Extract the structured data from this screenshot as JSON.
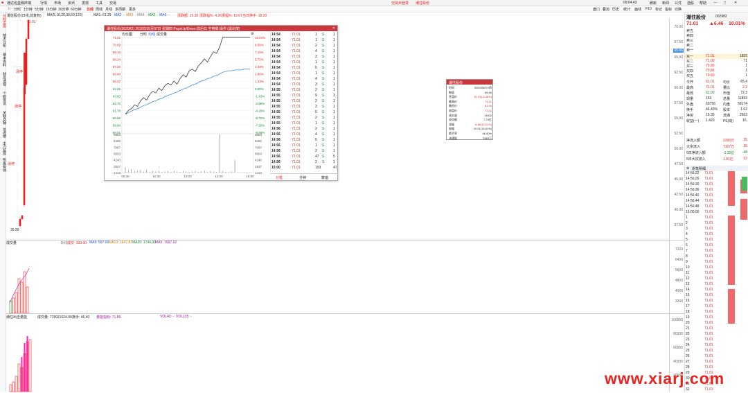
{
  "titlebar": {
    "app": "通达信金融终端",
    "menus": [
      "行情",
      "市场",
      "资讯",
      "发现",
      "工具",
      "交易"
    ],
    "center": "交易未登录",
    "stock_title": "潮住股份",
    "time": "09:04:43",
    "right_items": [
      "刷新",
      "新闻",
      "公式",
      "选股",
      "帮助"
    ]
  },
  "toolbar": {
    "items": [
      "□",
      "分时",
      "1分钟",
      "5分钟",
      "15分钟",
      "30分钟",
      "60分钟",
      "日线",
      "周线",
      "月线",
      "多周期",
      "更多"
    ],
    "right_items": [
      "盘口",
      "叠加",
      "历史",
      "统计",
      "画线",
      "F10",
      "标记",
      "指标",
      "切换"
    ]
  },
  "legend1": {
    "title": "潮住股份(日线,前复权)",
    "ma_label": "MA(5,10,20,30,60,120)",
    "ma1": "MA1: 61.29",
    "ma2": "MA2: -",
    "ma3": "MA3: -",
    "ma4": "MA4: -",
    "ma5": "MA5: -",
    "ma6": "MA6: -",
    "rise": "涨跌额: 15.30",
    "rise_pct": "涨跌幅%: 4.26",
    "turnover": "振幅%: 19.67",
    "vol_ratio": "当日换手: 18.20"
  },
  "lefttabs": [
    "分时走势",
    "技术分析",
    "基本资料",
    "财务透视",
    "个股资讯",
    "关联品种",
    "龙虎榜",
    "主力监控",
    "所属板块"
  ],
  "main_chart": {
    "high_label": "71.01",
    "low_label": "35.59",
    "annotations": [
      "涨停",
      "涨停",
      "涨停"
    ],
    "yaxis": [
      "70.00",
      "67.50",
      "65.00",
      "62.50",
      "60.00",
      "57.50",
      "55.00",
      "52.50",
      "50.00",
      "47.50",
      "45.00",
      "42.50",
      "40.00",
      "37.50"
    ],
    "yaxis_highlight": "65.66"
  },
  "volume_panel": {
    "title": "成交量",
    "vol": "成交: 333.00",
    "vol_ma1": "MA5: 587.00",
    "vol_ma2": "MA10: 1647.81",
    "vol_ma3": "MA20: 1744.00",
    "vol_ma4": "MA5: 7697.62",
    "yaxis": [
      "7200",
      "6400",
      "5600",
      "4800",
      "4000",
      "3200"
    ]
  },
  "indicator_panel": {
    "title": "潮住出击量能",
    "ind_vol": "成交量: 778921024.00",
    "ind_val": "换手: 46.40",
    "ind_name": "量能指标: 71.89",
    "ind_vol2": "VOL40: -",
    "ind_vol3": "VOL135: -",
    "yaxis": [
      "100000",
      "80000",
      "60000",
      "40000",
      "20000"
    ]
  },
  "popup": {
    "header": "潮住股份(002982) 2020年05月07日 星期四 PageUp/Down:前后日 空格键:操作 (退出按)",
    "tabs": [
      "均价图",
      "分时",
      "均线",
      "成交量"
    ],
    "left_axis": [
      "71.01",
      "70.09",
      "69.16",
      "68.24",
      "67.32",
      "66.40",
      "65.47",
      "64.55",
      "63.63",
      "62.70",
      "61.78",
      "60.86",
      "59.94",
      "59.01",
      "9883",
      "8480",
      "7067",
      "5653",
      "4240",
      "2827",
      "1413"
    ],
    "right_axis": [
      "10.01%",
      "8.58%",
      "7.15%",
      "5.72%",
      "4.29%",
      "2.86%",
      "1.43%",
      "0.00%",
      "-1.43%",
      "-2.86%",
      "-4.29%",
      "-5.72%",
      "-7.15%",
      "-8.58%",
      "9883",
      "8480",
      "7067",
      "5653",
      "4240",
      "2827",
      "1413"
    ],
    "x_axis": [
      "09:30",
      "10:30",
      "13:00",
      "14:00",
      "15:00"
    ],
    "price_series": [
      61.3,
      61.8,
      62.0,
      62.5,
      62.3,
      63.0,
      63.4,
      63.1,
      63.8,
      64.2,
      64.0,
      64.6,
      64.3,
      64.9,
      65.2,
      65.0,
      65.5,
      65.1,
      65.8,
      66.3,
      66.0,
      66.8,
      67.0,
      66.7,
      67.4,
      67.8,
      68.3,
      67.9,
      68.6,
      69.2,
      69.0,
      69.8,
      71.01,
      71.01,
      71.01,
      71.01,
      71.01,
      71.01,
      71.01,
      71.01,
      71.01,
      71.01
    ],
    "avg_series": [
      61.3,
      61.5,
      61.7,
      61.9,
      62.0,
      62.2,
      62.4,
      62.5,
      62.7,
      62.9,
      63.0,
      63.2,
      63.3,
      63.5,
      63.7,
      63.8,
      64.0,
      64.1,
      64.3,
      64.5,
      64.6,
      64.8,
      65.0,
      65.1,
      65.3,
      65.5,
      65.6,
      65.8,
      65.9,
      66.1,
      66.2,
      66.4,
      66.6,
      66.7,
      66.8,
      66.8,
      66.9,
      66.9,
      66.9,
      67.0,
      67.0,
      67.0
    ],
    "vol_series": [
      1400,
      600,
      900,
      400,
      500,
      700,
      300,
      600,
      200,
      400,
      300,
      500,
      200,
      300,
      400,
      200,
      500,
      300,
      200,
      400,
      300,
      200,
      300,
      400,
      200,
      300,
      500,
      200,
      400,
      300,
      200,
      9883,
      400,
      200,
      100,
      300,
      3200,
      100,
      50,
      100,
      80,
      60
    ],
    "trades": [
      {
        "t": "14:54",
        "p": "71.01",
        "v": "1",
        "s": "S",
        "n": "1"
      },
      {
        "t": "14:54",
        "p": "71.01",
        "v": "1",
        "s": "S",
        "n": "1"
      },
      {
        "t": "14:54",
        "p": "71.01",
        "v": "2",
        "s": "S",
        "n": "1"
      },
      {
        "t": "14:54",
        "p": "71.01",
        "v": "4",
        "s": "S",
        "n": "1"
      },
      {
        "t": "14:54",
        "p": "71.01",
        "v": "3",
        "s": "S",
        "n": "1"
      },
      {
        "t": "14:54",
        "p": "71.01",
        "v": "1",
        "s": "S",
        "n": "1"
      },
      {
        "t": "14:54",
        "p": "71.01",
        "v": "5",
        "s": "S",
        "n": "1"
      },
      {
        "t": "14:54",
        "p": "71.01",
        "v": "1",
        "s": "S",
        "n": "1"
      },
      {
        "t": "14:54",
        "p": "71.01",
        "v": "4",
        "s": "S",
        "n": "1"
      },
      {
        "t": "14:54",
        "p": "71.01",
        "v": "3",
        "s": "S",
        "n": "1"
      },
      {
        "t": "14:55",
        "p": "71.01",
        "v": "2",
        "s": "S",
        "n": "1"
      },
      {
        "t": "14:55",
        "p": "71.01",
        "v": "9",
        "s": "S",
        "n": "3"
      },
      {
        "t": "14:55",
        "p": "71.01",
        "v": "2",
        "s": "S",
        "n": "1"
      },
      {
        "t": "14:55",
        "p": "71.01",
        "v": "3",
        "s": "S",
        "n": "1"
      },
      {
        "t": "14:55",
        "p": "71.01",
        "v": "5",
        "s": "S",
        "n": "1"
      },
      {
        "t": "14:55",
        "p": "71.01",
        "v": "2",
        "s": "S",
        "n": "1"
      },
      {
        "t": "14:55",
        "p": "71.01",
        "v": "1",
        "s": "S",
        "n": "1"
      },
      {
        "t": "14:56",
        "p": "71.01",
        "v": "2",
        "s": "S",
        "n": "1"
      },
      {
        "t": "14:56",
        "p": "71.01",
        "v": "4",
        "s": "S",
        "n": "1"
      },
      {
        "t": "14:56",
        "p": "71.01",
        "v": "5",
        "s": "S",
        "n": "1"
      },
      {
        "t": "14:56",
        "p": "71.01",
        "v": "1",
        "s": "S",
        "n": "1"
      },
      {
        "t": "14:56",
        "p": "71.01",
        "v": "2",
        "s": "S",
        "n": "1"
      },
      {
        "t": "14:56",
        "p": "71.01",
        "v": "47",
        "s": "S",
        "n": "5"
      },
      {
        "t": "14:56",
        "p": "71.01",
        "v": "2",
        "s": "S",
        "n": "1"
      },
      {
        "t": "15:00",
        "p": "71.01",
        "v": "153",
        "s": "",
        "n": "47"
      }
    ],
    "foot": [
      "分笔",
      "分钟",
      "数值"
    ]
  },
  "infobox": {
    "title": "潮住股份",
    "rows": [
      {
        "k": "时间",
        "v": "2020/05/07/四"
      },
      {
        "k": "数值",
        "v": "65.66"
      },
      {
        "k": "开盘价",
        "v": "61.01(-5.46%)"
      },
      {
        "k": "最高价",
        "v": "71.01"
      },
      {
        "k": "最低价",
        "v": "61.00"
      },
      {
        "k": "收盘价",
        "v": "71.01"
      },
      {
        "k": "成交量",
        "v": "11602"
      },
      {
        "k": "成交额",
        "v": "7.79亿"
      },
      {
        "k": "涨幅",
        "v": "6.46(10.01%)"
      },
      {
        "k": "振幅",
        "v": "10.01(15.51%)"
      },
      {
        "k": "换手率",
        "v": "46.40%"
      },
      {
        "k": "流通股",
        "v": "2583万"
      }
    ]
  },
  "quote": {
    "name": "潮住股份",
    "code": "002982",
    "price": "71.01",
    "change": "▲6.46",
    "pct": "10.01%",
    "sell": [
      {
        "k": "卖五",
        "p": "",
        "v": ""
      },
      {
        "k": "卖四",
        "p": "",
        "v": ""
      },
      {
        "k": "卖三",
        "p": "",
        "v": ""
      },
      {
        "k": "卖二",
        "p": "",
        "v": ""
      },
      {
        "k": "卖一",
        "p": "",
        "v": ""
      }
    ],
    "buy": [
      {
        "k": "买一",
        "p": "71.01",
        "v": "1855"
      },
      {
        "k": "买二",
        "p": "71.00",
        "v": "71"
      },
      {
        "k": "买三",
        "p": "70.90",
        "v": "1"
      },
      {
        "k": "买四",
        "p": "70.86",
        "v": "1"
      },
      {
        "k": "买五",
        "p": "70.60",
        "v": "1"
      }
    ],
    "stats": [
      {
        "k1": "今开",
        "v1": "61.01",
        "k2": "均价",
        "v2": "65.4"
      },
      {
        "k1": "最高",
        "v1": "71.01",
        "k2": "量比",
        "v2": "2.2"
      },
      {
        "k1": "最低",
        "v1": "61.00",
        "k2": "市值",
        "v2": "72.3"
      },
      {
        "k1": "现量",
        "v1": "153",
        "k2": "总量",
        "v2": "11893"
      },
      {
        "k1": "外盘",
        "v1": "60756",
        "k2": "内盘",
        "v2": "58174"
      },
      {
        "k1": "换手",
        "v1": "46.40%",
        "k2": "股本",
        "v2": "1.02"
      },
      {
        "k1": "净资",
        "v1": "15.30",
        "k2": "流通",
        "v2": "2563"
      },
      {
        "k1": "收益(一)",
        "v1": "1.420",
        "k2": "PE(动)",
        "v2": "16."
      }
    ],
    "flow": [
      {
        "k": "净流入额",
        "v": "2395万",
        "v2": "35"
      },
      {
        "k": "大宗流入",
        "v": "7107万",
        "v2": "35"
      },
      {
        "k": "5日净流入额",
        "v": "-1.33亿",
        "v2": "-48"
      },
      {
        "k": "5日大宗流入",
        "v": "1.81亿",
        "v2": "52"
      }
    ],
    "tick_title": "逐笔明细",
    "ticks_time": [
      "14:56:22",
      "14:56:26",
      "14:56:30",
      "14:56:36",
      "14:56:40",
      "14:56:44",
      "14:56:48",
      "15:00:00"
    ],
    "tick_rows": 40,
    "tick_price": "71.01"
  },
  "watermark": "www.xiarj.com"
}
